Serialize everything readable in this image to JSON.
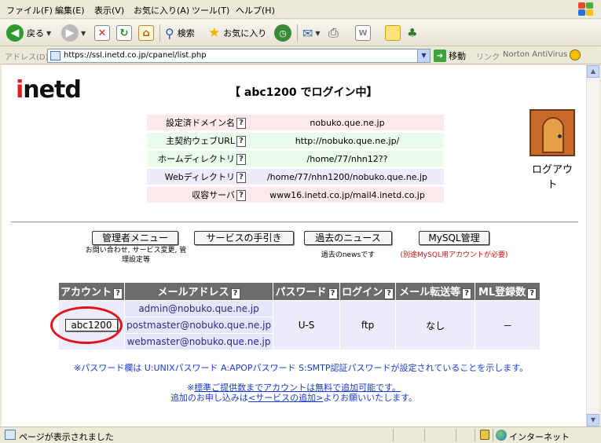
{
  "menu": [
    "ファイル(F)",
    "編集(E)",
    "表示(V)",
    "お気に入り(A)",
    "ツール(T)",
    "ヘルプ(H)"
  ],
  "toolbar": {
    "back_label": "戻る",
    "search_label": "検索",
    "favorites_label": "お気に入り"
  },
  "address": {
    "label": "アドレス(D)",
    "url": "https://ssl.inetd.co.jp/cpanel/list.php",
    "go_label": "移動",
    "links_label": "リンク",
    "norton_label": "Norton AntiVirus"
  },
  "page": {
    "logo_first": "i",
    "logo_rest": "netd",
    "login_message": "【 abc1200 でログイン中】",
    "info_rows": [
      {
        "key": "設定済ドメイン名",
        "value": "nobuko.que.ne.jp"
      },
      {
        "key": "主契約ウェブURL",
        "value": "http://nobuko.que.ne.jp/"
      },
      {
        "key": "ホームディレクトリ",
        "value": "/home/77/nhn12??"
      },
      {
        "key": "Webディレクトリ",
        "value": "/home/77/nhn1200/nobuko.que.ne.jp"
      },
      {
        "key": "収容サーバ",
        "value": "www16.inetd.co.jp/mail4.inetd.co.jp"
      }
    ],
    "help_mark": "?",
    "logout_label": "ログアウト",
    "buttons": [
      {
        "label": "管理者メニュー",
        "sub": "お問い合わせ, サービス変更, 管理設定等"
      },
      {
        "label": "サービスの手引き",
        "sub": ""
      },
      {
        "label": "過去のニュース",
        "sub": "過去のnewsです"
      },
      {
        "label": "MySQL管理",
        "sub": "(別途MySQL用アカウントが必要)"
      }
    ],
    "table": {
      "headers": [
        "アカウント",
        "メールアドレス",
        "パスワード",
        "ログイン",
        "メール転送等",
        "ML登録数"
      ],
      "account": "abc1200",
      "emails": [
        "admin@nobuko.que.ne.jp",
        "postmaster@nobuko.que.ne.jp",
        "webmaster@nobuko.que.ne.jp"
      ],
      "password": "U-S",
      "login": "ftp",
      "forward": "なし",
      "ml_count": "－"
    },
    "note_password": "※パスワード欄は U:UNIXパスワード A:APOPパスワード S:SMTP認証パスワードが設定されていることを示します。",
    "note_add_prefix": "※",
    "note_add_link": "標準ご提供数までアカウントは無料で追加可能です。",
    "note_apply_prefix": "追加のお申し込みは",
    "note_apply_link": "<サービスの追加>",
    "note_apply_suffix": "よりお願いいたします。"
  },
  "status": {
    "text": "ページが表示されました",
    "zone": "インターネット"
  }
}
